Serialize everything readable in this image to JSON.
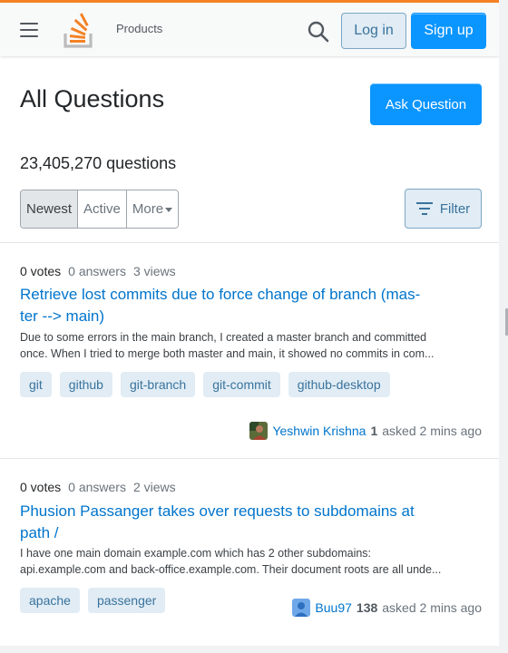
{
  "header": {
    "menu_icon": "hamburger-icon",
    "logo_icon": "stackoverflow-logo",
    "products_label": "Products",
    "search_icon": "search-icon",
    "login_label": "Log in",
    "signup_label": "Sign up",
    "accent_color": "#f48225"
  },
  "main": {
    "title": "All Questions",
    "ask_label": "Ask Question",
    "question_count": "23,405,270 questions",
    "sort_options": [
      "Newest",
      "Active",
      "More"
    ],
    "active_sort": "Newest",
    "filter_label": "Filter"
  },
  "questions": [
    {
      "votes": "0 votes",
      "answers": "0 answers",
      "views": "3 views",
      "title_line1": "Retrieve lost commits due to force change of branch (mas-",
      "title_line2": "ter --> main)",
      "excerpt_line1": "Due to some errors in the main branch, I created a master branch and committed",
      "excerpt_line2": "once. When I tried to merge both master and main, it showed no commits in com...",
      "tags": [
        "git",
        "github",
        "git-branch",
        "git-commit",
        "github-desktop"
      ],
      "user": "Yeshwin Krishna",
      "reputation": "1",
      "time": "asked 2 mins ago"
    },
    {
      "votes": "0 votes",
      "answers": "0 answers",
      "views": "2 views",
      "title_line1": "Phusion Passanger takes over requests to subdomains at",
      "title_line2": "path /",
      "excerpt_line1": "I have one main domain example.com which has 2 other subdomains:",
      "excerpt_line2": "api.example.com and back-office.example.com. Their document roots are all unde...",
      "tags": [
        "apache",
        "passenger"
      ],
      "user": "Buu97",
      "reputation": "138",
      "time": "asked 2 mins ago"
    }
  ]
}
